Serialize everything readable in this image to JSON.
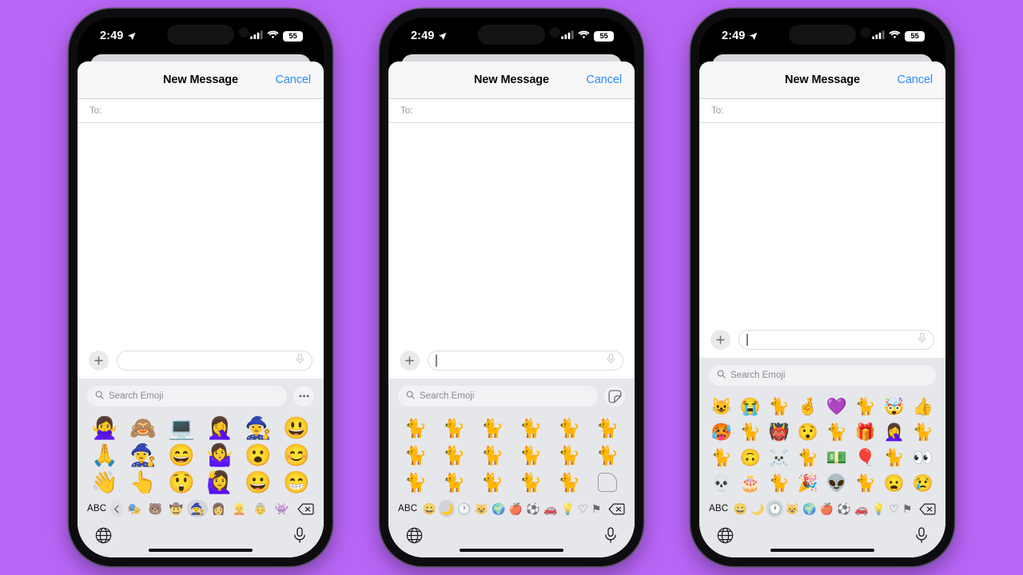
{
  "background_color": "#b865f6",
  "accent_color": "#2d8bf5",
  "status_bar": {
    "time": "2:49",
    "location_icon": "location-arrow-icon",
    "cellular_icon": "cellular-bars-icon",
    "wifi_icon": "wifi-icon",
    "battery_level": "55"
  },
  "nav": {
    "title": "New Message",
    "cancel_label": "Cancel"
  },
  "recipient": {
    "label": "To:"
  },
  "compose": {
    "plus_icon": "plus-icon",
    "mic_icon": "microphone-icon",
    "value": ""
  },
  "keyboard": {
    "search_placeholder": "Search Emoji",
    "search_icon": "magnifier-icon",
    "abc_label": "ABC",
    "delete_icon": "delete-backward-icon",
    "globe_icon": "globe-icon",
    "dictation_icon": "microphone-icon",
    "more_icon": "ellipsis-icon",
    "new_sticker_icon": "new-sticker-icon",
    "back_chevron_icon": "chevron-left-icon"
  },
  "phones": [
    {
      "id": "phone-memoji",
      "search_trailing_button": "ellipsis-icon",
      "caret_visible": false,
      "grid_columns": 6,
      "grid_kind": "memoji-stickers",
      "grid_items": [
        "🙅‍♀️",
        "🙈",
        "💻",
        "🤦‍♀️",
        "🧙‍♀️",
        "😃",
        "🙏",
        "🧙‍♀️",
        "😄",
        "🤷‍♀️",
        "😮",
        "😊",
        "👋",
        "👆",
        "😲",
        "🙋‍♀️",
        "😀",
        "😁"
      ],
      "categories": [
        {
          "icon": "chevron-left-icon",
          "name": "back-chevron",
          "selected": false,
          "style": "chevron"
        },
        {
          "icon": "🎭",
          "name": "memoji-1",
          "selected": false
        },
        {
          "icon": "🐻",
          "name": "memoji-2",
          "selected": false
        },
        {
          "icon": "🤠",
          "name": "memoji-3",
          "selected": false
        },
        {
          "icon": "🧙",
          "name": "memoji-4",
          "selected": true
        },
        {
          "icon": "👩",
          "name": "memoji-5",
          "selected": false
        },
        {
          "icon": "👱",
          "name": "memoji-6",
          "selected": false
        },
        {
          "icon": "👵",
          "name": "memoji-7",
          "selected": false
        },
        {
          "icon": "👾",
          "name": "memoji-8",
          "selected": false
        }
      ]
    },
    {
      "id": "phone-cat-stickers",
      "search_trailing_button": "new-sticker-icon",
      "caret_visible": true,
      "grid_columns": 6,
      "grid_kind": "photo-stickers",
      "grid_items": [
        "🐈",
        "🐈",
        "🐈",
        "🐈",
        "🐈",
        "🐈",
        "🐈",
        "🐈",
        "🐈",
        "🐈",
        "🐈",
        "🐈",
        "🐈",
        "🐈",
        "🐈",
        "🐈",
        "🐈",
        "new-sticker"
      ],
      "categories": [
        {
          "icon": "😀",
          "name": "smileys-people",
          "selected": false
        },
        {
          "icon": "🌙",
          "name": "stickers",
          "selected": true
        },
        {
          "icon": "🕐",
          "name": "recents",
          "selected": false
        },
        {
          "icon": "😺",
          "name": "animals-nature",
          "selected": false
        },
        {
          "icon": "🌍",
          "name": "travel-places",
          "selected": false
        },
        {
          "icon": "🍎",
          "name": "food-drink",
          "selected": false
        },
        {
          "icon": "⚽",
          "name": "activity",
          "selected": false
        },
        {
          "icon": "🚗",
          "name": "objects-travel",
          "selected": false
        },
        {
          "icon": "💡",
          "name": "objects",
          "selected": false
        },
        {
          "icon": "♡",
          "name": "symbols",
          "selected": false
        },
        {
          "icon": "⚑",
          "name": "flags",
          "selected": false
        }
      ]
    },
    {
      "id": "phone-recents",
      "search_trailing_button": "none",
      "caret_visible": true,
      "grid_columns": 8,
      "grid_kind": "recents-emoji",
      "grid_items": [
        "😺",
        "😭",
        "🐈",
        "🤞",
        "💜",
        "🐈",
        "🤯",
        "👍",
        "🥵",
        "🐈",
        "👹",
        "😯",
        "🐈",
        "🎁",
        "🤦‍♀️",
        "🐈",
        "🐈",
        "🙃",
        "☠️",
        "🐈",
        "💵",
        "🎈",
        "🐈",
        "👀",
        "💀",
        "🎂",
        "🐈",
        "🎉",
        "👽",
        "🐈",
        "😦",
        "😢"
      ],
      "categories": [
        {
          "icon": "😀",
          "name": "smileys-people",
          "selected": false
        },
        {
          "icon": "🌙",
          "name": "stickers",
          "selected": false
        },
        {
          "icon": "🕐",
          "name": "recents",
          "selected": true
        },
        {
          "icon": "😺",
          "name": "animals-nature",
          "selected": false
        },
        {
          "icon": "🌍",
          "name": "travel-places",
          "selected": false
        },
        {
          "icon": "🍎",
          "name": "food-drink",
          "selected": false
        },
        {
          "icon": "⚽",
          "name": "activity",
          "selected": false
        },
        {
          "icon": "🚗",
          "name": "objects-travel",
          "selected": false
        },
        {
          "icon": "💡",
          "name": "objects",
          "selected": false
        },
        {
          "icon": "♡",
          "name": "symbols",
          "selected": false
        },
        {
          "icon": "⚑",
          "name": "flags",
          "selected": false
        }
      ]
    }
  ]
}
